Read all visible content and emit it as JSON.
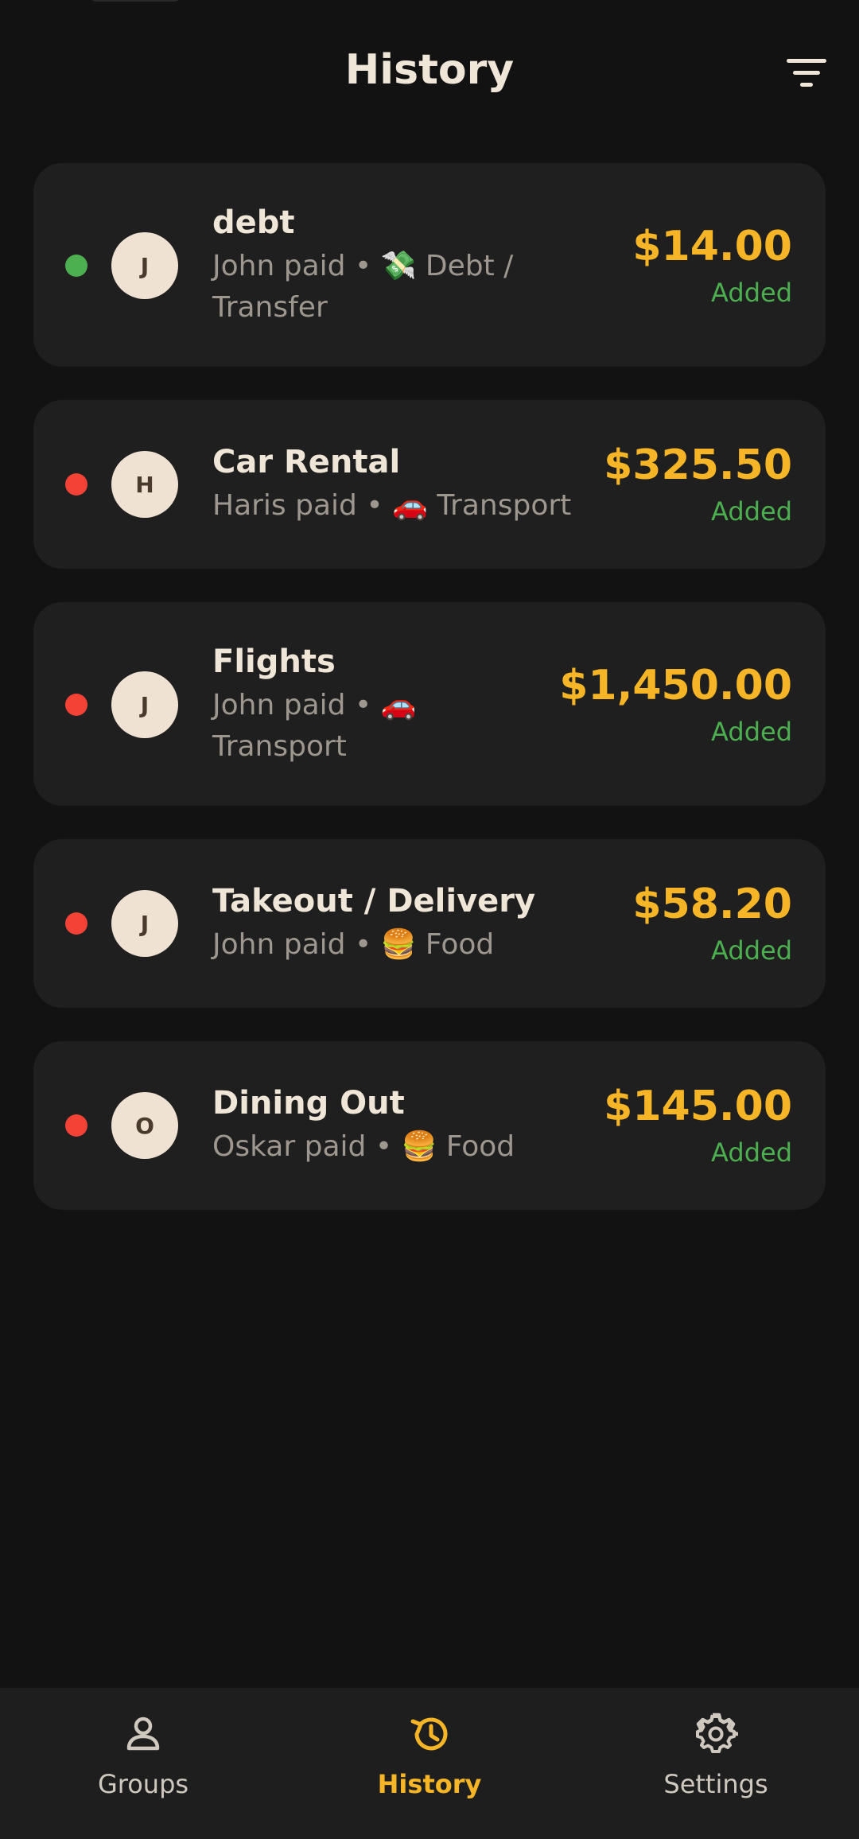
{
  "header": {
    "title": "History"
  },
  "transactions": [
    {
      "title": "debt",
      "payer": "John paid",
      "separator": "•",
      "category_emoji": "💸",
      "category": "Debt / Transfer",
      "avatar_initial": "J",
      "amount": "$14.00",
      "status": "Added",
      "dot_color": "#4caf50"
    },
    {
      "title": "Car Rental",
      "payer": "Haris paid",
      "separator": "•",
      "category_emoji": "🚗",
      "category": "Transport",
      "avatar_initial": "H",
      "amount": "$325.50",
      "status": "Added",
      "dot_color": "#f44336"
    },
    {
      "title": "Flights",
      "payer": "John paid",
      "separator": "•",
      "category_emoji": "🚗",
      "category": "Transport",
      "avatar_initial": "J",
      "amount": "$1,450.00",
      "status": "Added",
      "dot_color": "#f44336"
    },
    {
      "title": "Takeout / Delivery",
      "payer": "John paid",
      "separator": "•",
      "category_emoji": "🍔",
      "category": "Food",
      "avatar_initial": "J",
      "amount": "$58.20",
      "status": "Added",
      "dot_color": "#f44336"
    },
    {
      "title": "Dining Out",
      "payer": "Oskar paid",
      "separator": "•",
      "category_emoji": "🍔",
      "category": "Food",
      "avatar_initial": "O",
      "amount": "$145.00",
      "status": "Added",
      "dot_color": "#f44336"
    }
  ],
  "bottom_nav": {
    "items": [
      {
        "label": "Groups",
        "icon": "person-icon",
        "active": false
      },
      {
        "label": "History",
        "icon": "history-icon",
        "active": true
      },
      {
        "label": "Settings",
        "icon": "gear-icon",
        "active": false
      }
    ]
  },
  "colors": {
    "background": "#121212",
    "card": "#1f1f1f",
    "accent": "#f6b527",
    "positive": "#4caf50",
    "negative": "#f44336",
    "avatar_bg": "#efe2d2",
    "text_primary": "#f0e6d8",
    "text_secondary": "#9e978f"
  }
}
